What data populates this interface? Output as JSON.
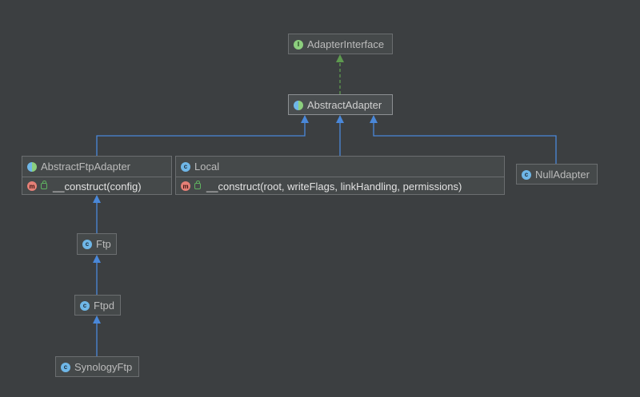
{
  "nodes": {
    "adapter_interface": {
      "label": "AdapterInterface",
      "icon": "interface-icon",
      "icon_letter": "I"
    },
    "abstract_adapter": {
      "label": "AbstractAdapter",
      "icon": "abstract-class-icon",
      "icon_letter": ""
    },
    "abstract_ftp_adapter": {
      "label": "AbstractFtpAdapter",
      "icon": "abstract-class-icon",
      "icon_letter": "",
      "members": [
        {
          "name": "__construct(config)",
          "icon": "method-icon",
          "icon_letter": "m"
        }
      ]
    },
    "local": {
      "label": "Local",
      "icon": "class-icon",
      "icon_letter": "c",
      "members": [
        {
          "name": "__construct(root, writeFlags, linkHandling, permissions)",
          "icon": "method-icon",
          "icon_letter": "m"
        }
      ]
    },
    "null_adapter": {
      "label": "NullAdapter",
      "icon": "class-icon",
      "icon_letter": "c"
    },
    "ftp": {
      "label": "Ftp",
      "icon": "class-icon",
      "icon_letter": "c"
    },
    "ftpd": {
      "label": "Ftpd",
      "icon": "class-icon",
      "icon_letter": "c"
    },
    "synology_ftp": {
      "label": "SynologyFtp",
      "icon": "class-icon",
      "icon_letter": "c"
    }
  },
  "relations": [
    {
      "from": "AbstractAdapter",
      "to": "AdapterInterface",
      "kind": "implements"
    },
    {
      "from": "AbstractFtpAdapter",
      "to": "AbstractAdapter",
      "kind": "extends"
    },
    {
      "from": "Local",
      "to": "AbstractAdapter",
      "kind": "extends"
    },
    {
      "from": "NullAdapter",
      "to": "AbstractAdapter",
      "kind": "extends"
    },
    {
      "from": "Ftp",
      "to": "AbstractFtpAdapter",
      "kind": "extends"
    },
    {
      "from": "Ftpd",
      "to": "Ftp",
      "kind": "extends"
    },
    {
      "from": "SynologyFtp",
      "to": "Ftpd",
      "kind": "extends"
    }
  ],
  "colors": {
    "background": "#3c3f41",
    "extends_edge": "#4a88d9",
    "implements_edge": "#5e9a4f",
    "class_icon": "#6fb7e8",
    "interface_icon": "#8ccf7e",
    "method_icon": "#e57f76"
  }
}
